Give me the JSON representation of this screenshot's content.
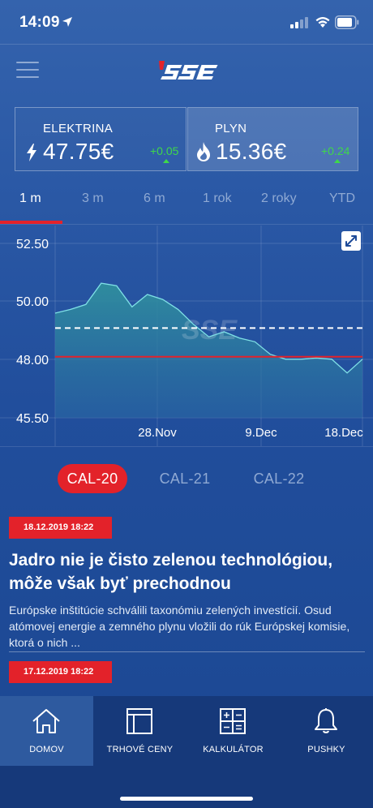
{
  "status_bar": {
    "time": "14:09"
  },
  "header": {
    "logo_text": "SSE"
  },
  "cards": {
    "electrina": {
      "title": "ELEKTRINA",
      "value": "47.75€",
      "change": "+0.05",
      "icon": "bolt-icon"
    },
    "plyn": {
      "title": "PLYN",
      "value": "15.36€",
      "change": "+0.24",
      "icon": "flame-icon"
    }
  },
  "period_tabs": [
    {
      "label": "1 m",
      "active": true
    },
    {
      "label": "3 m",
      "active": false
    },
    {
      "label": "6 m",
      "active": false
    },
    {
      "label": "1 rok",
      "active": false
    },
    {
      "label": "2 roky",
      "active": false
    },
    {
      "label": "YTD",
      "active": false
    }
  ],
  "chart_data": {
    "type": "area",
    "y_ticks": [
      "52.50",
      "50.00",
      "48.00",
      "45.50"
    ],
    "ylim": [
      45.5,
      52.5
    ],
    "x_ticks": [
      "28.Nov",
      "9.Dec",
      "18.Dec"
    ],
    "grid": true,
    "series": [
      {
        "values": [
          49.7,
          49.85,
          50.05,
          50.9,
          50.8,
          49.95,
          50.45,
          50.25,
          49.85,
          49.25,
          48.75,
          48.95,
          48.7,
          48.55,
          48.05,
          47.85,
          47.85,
          47.9,
          47.85,
          47.3,
          47.85
        ]
      }
    ],
    "reference_lines": [
      {
        "value": 49.1,
        "style": "dashed",
        "color": "#ffffff"
      },
      {
        "value": 47.95,
        "style": "solid",
        "color": "#e3222a"
      }
    ],
    "watermark": "SSE"
  },
  "cal_selector": [
    {
      "label": "CAL-20",
      "active": true
    },
    {
      "label": "CAL-21",
      "active": false
    },
    {
      "label": "CAL-22",
      "active": false
    }
  ],
  "news": [
    {
      "date": "18.12.2019 18:22",
      "title": "Jadro nie je čisto zelenou technológiou, môže však byť prechodnou",
      "text": "Európske inštitúcie schválili taxonómiu zelených investícií. Osud atómovej energie a zemného plynu vložili do rúk Európskej komisie, ktorá o nich ..."
    },
    {
      "date": "17.12.2019 18:22"
    }
  ],
  "bottom_nav": [
    {
      "label": "DOMOV",
      "icon": "home-icon",
      "active": true
    },
    {
      "label": "TRHOVÉ CENY",
      "icon": "market-prices-icon",
      "active": false
    },
    {
      "label": "KALKULÁTOR",
      "icon": "calculator-icon",
      "active": false
    },
    {
      "label": "PUSHKY",
      "icon": "bell-icon",
      "active": false
    }
  ],
  "colors": {
    "accent_red": "#e3222a",
    "positive_green": "#3fd84a",
    "background_blue": "#2a58a5",
    "muted_text": "#8fa9d3"
  }
}
